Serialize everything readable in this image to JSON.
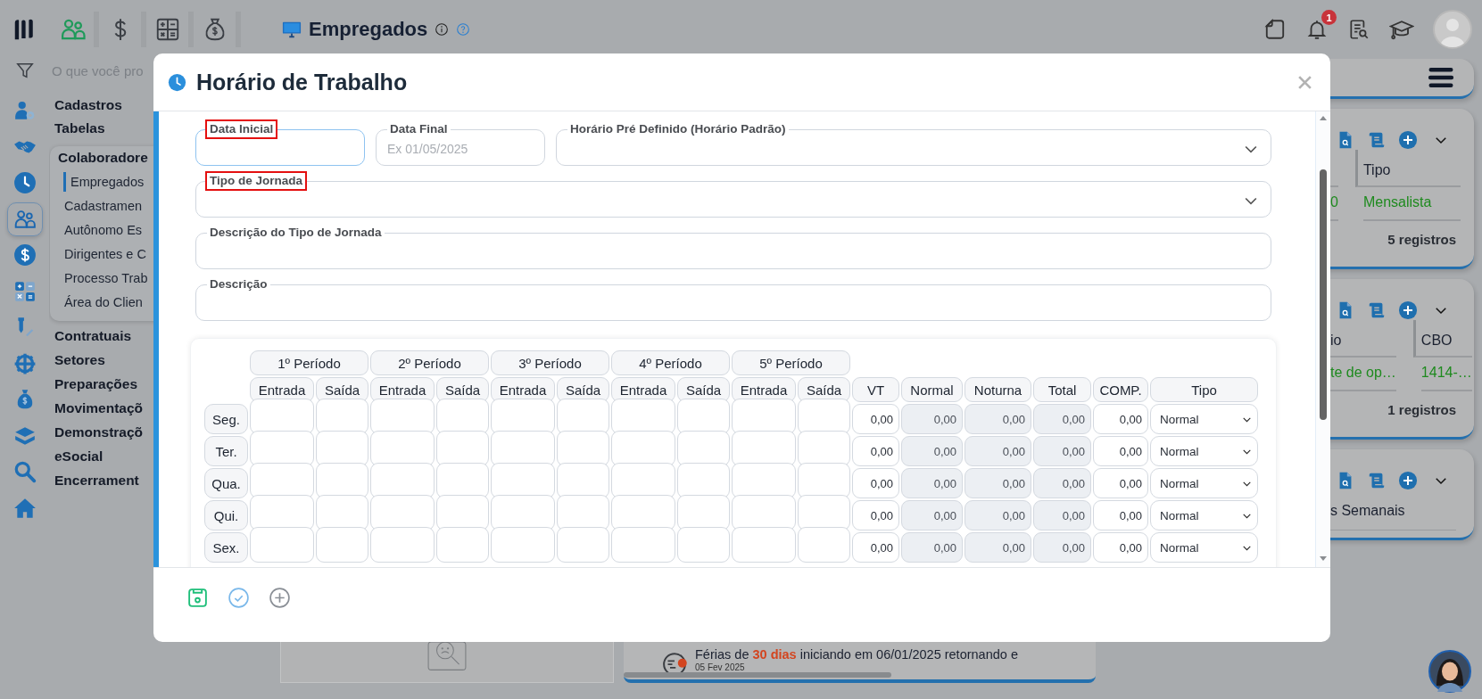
{
  "topbar": {
    "modules": [
      {
        "selected": true
      },
      {
        "selected": false
      },
      {
        "selected": false
      },
      {
        "selected": false
      }
    ],
    "page_title": "Empregados",
    "notification_count": "1"
  },
  "search": {
    "placeholder": "O que você pro"
  },
  "rail": [
    {
      "selected": false
    },
    {
      "selected": false
    },
    {
      "selected": false
    },
    {
      "selected": true
    },
    {
      "selected": false
    },
    {
      "selected": false
    },
    {
      "selected": false
    },
    {
      "selected": false
    },
    {
      "selected": false
    },
    {
      "selected": false
    },
    {
      "selected": false
    },
    {
      "selected": false
    }
  ],
  "menu": [
    {
      "label": "Cadastros",
      "expanded": false
    },
    {
      "label": "Tabelas",
      "expanded": false
    },
    {
      "label": "Colaboradore",
      "expanded": true,
      "children": [
        {
          "label": "Empregados",
          "selected": true
        },
        {
          "label": "Cadastramen",
          "selected": false
        },
        {
          "label": "Autônomo Es",
          "selected": false
        },
        {
          "label": "Dirigentes e C",
          "selected": false
        },
        {
          "label": "Processo Trab",
          "selected": false
        },
        {
          "label": "Área do Clien",
          "selected": false
        }
      ]
    },
    {
      "label": "Contratuais",
      "expanded": false
    },
    {
      "label": "Setores",
      "expanded": false
    },
    {
      "label": "Preparações",
      "expanded": false
    },
    {
      "label": "Movimentaçõ",
      "expanded": false
    },
    {
      "label": "Demonstraçõ",
      "expanded": false
    },
    {
      "label": "eSocial",
      "expanded": false
    },
    {
      "label": "Encerrament",
      "expanded": false
    }
  ],
  "cards": [
    {
      "kind": "menu"
    },
    {
      "kind": "list",
      "headers": [
        "Tipo"
      ],
      "cells": [
        "0",
        "Mensalista"
      ],
      "footer": "5 registros"
    },
    {
      "kind": "list",
      "headers": [
        "io",
        "CBO"
      ],
      "cells": [
        "te de op…",
        "1414-…"
      ],
      "footer": "1 registros"
    },
    {
      "kind": "list",
      "title": "s Semanais"
    }
  ],
  "notice": {
    "text": "Férias de **30 dias** iniciando em 06/01/2025 retornando e",
    "date": "05 Fev 2025"
  },
  "modal": {
    "title": "Horário de Trabalho",
    "field_rows": [
      [
        {
          "kind": "input",
          "label": "Data Inicial",
          "highlighted": true,
          "focused": true
        },
        {
          "kind": "input",
          "label": "Data Final",
          "placeholder": "Ex 01/05/2025",
          "highlighted": false,
          "focused": false
        },
        {
          "kind": "select",
          "label": "Horário Pré Definido (Horário Padrão)",
          "highlighted": false,
          "focused": false
        }
      ],
      [
        {
          "kind": "select",
          "label": "Tipo de Jornada",
          "highlighted": true,
          "focused": false
        }
      ],
      [
        {
          "kind": "input",
          "label": "Descrição do Tipo de Jornada",
          "highlighted": false,
          "focused": false
        }
      ],
      [
        {
          "kind": "input",
          "label": "Descrição",
          "highlighted": false,
          "focused": false
        }
      ]
    ],
    "table": {
      "periods": [
        {
          "label": "1º Período",
          "columns": [
            "Entrada",
            "Saída"
          ]
        },
        {
          "label": "2º Período",
          "columns": [
            "Entrada",
            "Saída"
          ]
        },
        {
          "label": "3º Período",
          "columns": [
            "Entrada",
            "Saída"
          ]
        },
        {
          "label": "4º Período",
          "columns": [
            "Entrada",
            "Saída"
          ]
        },
        {
          "label": "5º Período",
          "columns": [
            "Entrada",
            "Saída"
          ]
        }
      ],
      "value_columns": [
        {
          "label": "VT",
          "readonly": false
        },
        {
          "label": "Normal",
          "readonly": true
        },
        {
          "label": "Noturna",
          "readonly": true
        },
        {
          "label": "Total",
          "readonly": true
        },
        {
          "label": "COMP.",
          "readonly": false
        }
      ],
      "type_column": "Tipo",
      "rows": [
        {
          "day": "Seg.",
          "values": [
            "0,00",
            "0,00",
            "0,00",
            "0,00",
            "0,00"
          ],
          "type": "Normal"
        },
        {
          "day": "Ter.",
          "values": [
            "0,00",
            "0,00",
            "0,00",
            "0,00",
            "0,00"
          ],
          "type": "Normal"
        },
        {
          "day": "Qua.",
          "values": [
            "0,00",
            "0,00",
            "0,00",
            "0,00",
            "0,00"
          ],
          "type": "Normal"
        },
        {
          "day": "Qui.",
          "values": [
            "0,00",
            "0,00",
            "0,00",
            "0,00",
            "0,00"
          ],
          "type": "Normal"
        },
        {
          "day": "Sex.",
          "values": [
            "0,00",
            "0,00",
            "0,00",
            "0,00",
            "0,00"
          ],
          "type": "Normal"
        }
      ]
    }
  }
}
